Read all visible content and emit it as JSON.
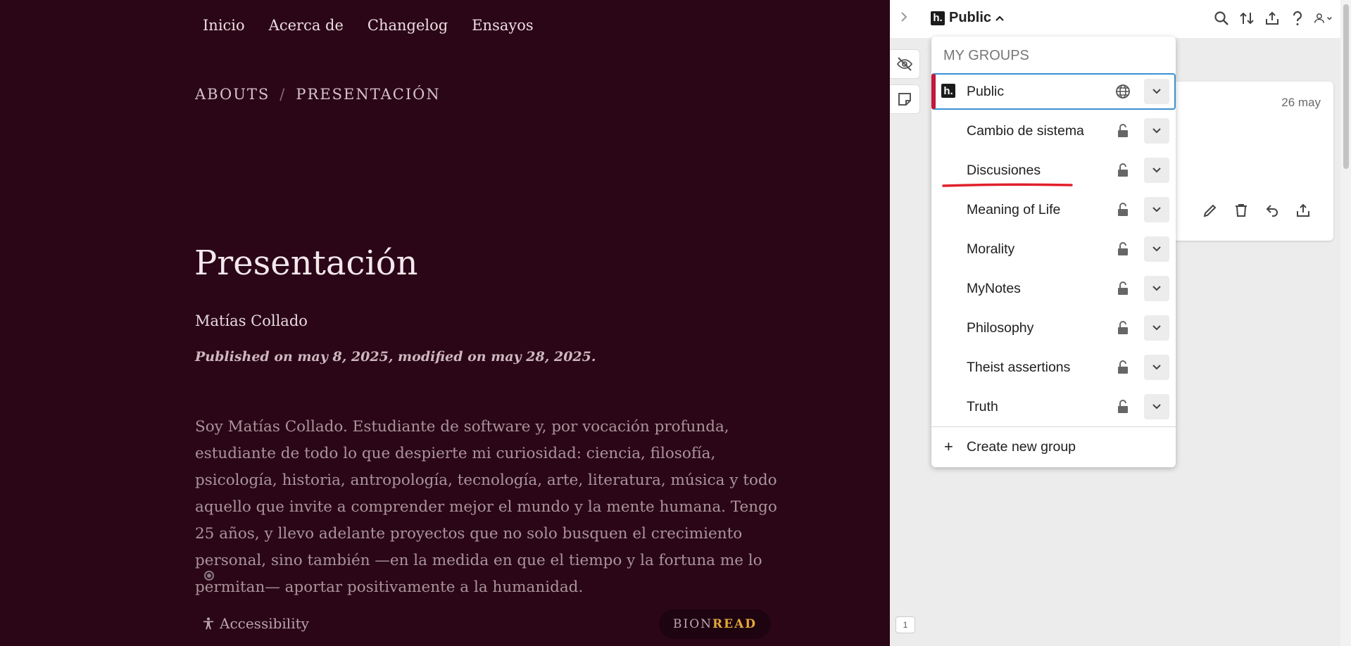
{
  "nav": {
    "items": [
      "Inicio",
      "Acerca de",
      "Changelog",
      "Ensayos"
    ]
  },
  "breadcrumb": {
    "parent": "ABOUTS",
    "separator": "/",
    "current": "PRESENTACIÓN"
  },
  "article": {
    "title": "Presentación",
    "author": "Matías Collado",
    "published": "Published on may 8, 2025,  modified on may 28, 2025.",
    "body": "Soy Matías Collado. Estudiante de software y, por vocación profunda, estudiante de todo lo que despierte mi curiosidad: ciencia, filosofía, psicología, historia, antropología, tecnología, arte, literatura, música y todo aquello que invite a comprender mejor el mundo y la mente humana. Tengo 25 años, y llevo adelante proyectos que no solo busquen el crecimiento personal, sino también —en la medida en que el tiempo y la fortuna me lo permitan— aportar positivamente a la humanidad."
  },
  "footer": {
    "accessibility": "Accessibility",
    "bionread_a": "BION",
    "bionread_b": "READ"
  },
  "sidebar": {
    "current_group": "Public",
    "logo_letter": "h.",
    "notification_count": "1",
    "card": {
      "date": "26 may"
    },
    "menu": {
      "heading": "MY GROUPS",
      "groups": [
        {
          "name": "Public",
          "type": "public",
          "selected": true
        },
        {
          "name": "Cambio de sistema",
          "type": "restricted"
        },
        {
          "name": "Discusiones",
          "type": "restricted"
        },
        {
          "name": "Meaning of Life",
          "type": "restricted"
        },
        {
          "name": "Morality",
          "type": "restricted"
        },
        {
          "name": "MyNotes",
          "type": "restricted"
        },
        {
          "name": "Philosophy",
          "type": "restricted"
        },
        {
          "name": "Theist assertions",
          "type": "restricted"
        },
        {
          "name": "Truth",
          "type": "restricted"
        }
      ],
      "create_label": "Create new group"
    }
  },
  "colors": {
    "page_bg": "#2b0617",
    "accent_red": "#c0193a",
    "focus_blue": "#3a91d2",
    "bionread_gold": "#e3a93a",
    "annotation_red": "#e0202a"
  }
}
